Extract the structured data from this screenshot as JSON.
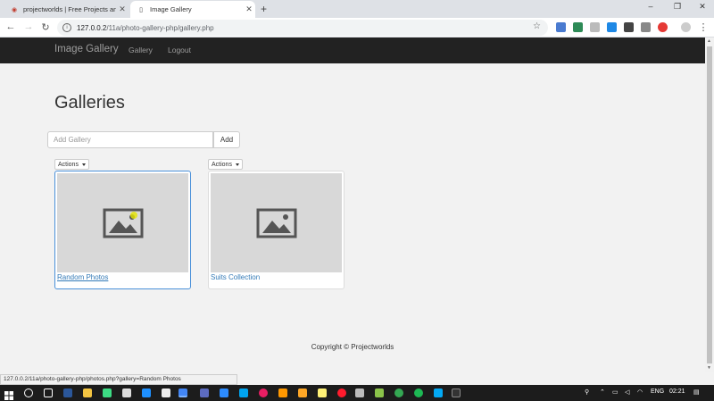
{
  "browser": {
    "tabs": [
      {
        "title": "projectworlds | Free Projects and",
        "active": false
      },
      {
        "title": "Image Gallery",
        "active": true
      }
    ],
    "new_tab_icon": "+",
    "window_controls": {
      "minimize": "–",
      "restore": "❐",
      "close": "✕"
    },
    "url_host": "127.0.0.2",
    "url_path": "/11a/photo-gallery-php/gallery.php",
    "status_url": "127.0.0.2/11a/photo-gallery-php/photos.php?gallery=Random Photos"
  },
  "site": {
    "brand": "Image Gallery",
    "nav": [
      "Gallery",
      "Logout"
    ]
  },
  "page": {
    "heading": "Galleries",
    "add_placeholder": "Add Gallery",
    "add_button": "Add",
    "actions_label": "Actions",
    "galleries": [
      {
        "name": "Random Photos",
        "icon": "image-placeholder-icon"
      },
      {
        "name": "Suits Collection",
        "icon": "image-placeholder-icon"
      }
    ],
    "footer": "Copyright © Projectworlds"
  },
  "taskbar": {
    "language": "ENG",
    "time": "02:21"
  },
  "colors": {
    "navbar": "#222222",
    "link": "#337ab7",
    "page_bg": "#f2f2f2",
    "taskbar": "#1c1c1c",
    "selected_border": "#4a90d9"
  }
}
